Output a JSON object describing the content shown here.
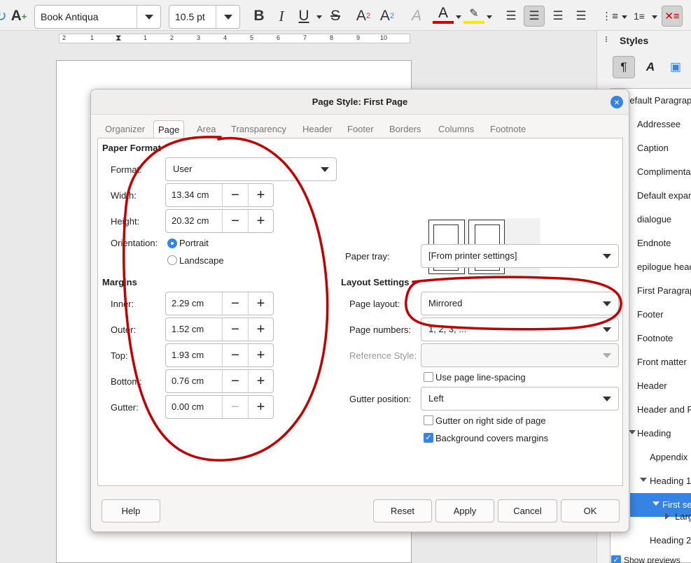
{
  "toolbar": {
    "font_name": "Book Antiqua",
    "font_size": "10.5 pt",
    "ruler_numbers": [
      "2",
      "1",
      "1",
      "2",
      "3",
      "4",
      "5",
      "6",
      "7",
      "8",
      "9",
      "10"
    ]
  },
  "sidebar": {
    "title": "Styles",
    "items": [
      {
        "label": "Default Paragraph"
      },
      {
        "label": "Addressee"
      },
      {
        "label": "Caption"
      },
      {
        "label": "Complimentary"
      },
      {
        "label": "Default expand"
      },
      {
        "label": "dialogue"
      },
      {
        "label": "Endnote"
      },
      {
        "label": "epilogue head"
      },
      {
        "label": "First Paragraph"
      },
      {
        "label": "Footer"
      },
      {
        "label": "Footnote"
      },
      {
        "label": "Front matter"
      },
      {
        "label": "Header"
      },
      {
        "label": "Header and F"
      },
      {
        "label": "Heading"
      },
      {
        "label": "Appendix"
      },
      {
        "label": "Heading 1"
      },
      {
        "label": "First se"
      },
      {
        "label": "Larg"
      },
      {
        "label": "Heading 2"
      }
    ],
    "show_previews": "Show previews"
  },
  "dialog": {
    "title": "Page Style: First Page",
    "tabs": [
      "Organizer",
      "Page",
      "Area",
      "Transparency",
      "Header",
      "Footer",
      "Borders",
      "Columns",
      "Footnote"
    ],
    "active_tab": "Page",
    "paper_format": {
      "section": "Paper Format",
      "format_label": "Format:",
      "format_value": "User",
      "width_label": "Width:",
      "width_value": "13.34 cm",
      "height_label": "Height:",
      "height_value": "20.32 cm",
      "orientation_label": "Orientation:",
      "portrait": "Portrait",
      "landscape": "Landscape",
      "paper_tray_label": "Paper tray:",
      "paper_tray_value": "[From printer settings]"
    },
    "margins": {
      "section": "Margins",
      "inner_label": "Inner:",
      "inner_value": "2.29 cm",
      "outer_label": "Outer:",
      "outer_value": "1.52 cm",
      "top_label": "Top:",
      "top_value": "1.93 cm",
      "bottom_label": "Bottom:",
      "bottom_value": "0.76 cm",
      "gutter_label": "Gutter:",
      "gutter_value": "0.00 cm"
    },
    "layout": {
      "section": "Layout Settings",
      "page_layout_label": "Page layout:",
      "page_layout_value": "Mirrored",
      "page_numbers_label": "Page numbers:",
      "page_numbers_value": "1, 2, 3, ...",
      "reference_style_label": "Reference Style:",
      "reference_style_value": "",
      "line_spacing_label": "Use page line-spacing",
      "gutter_position_label": "Gutter position:",
      "gutter_position_value": "Left",
      "gutter_right_label": "Gutter on right side of page",
      "bg_covers_label": "Background covers margins"
    },
    "buttons": {
      "help": "Help",
      "reset": "Reset",
      "apply": "Apply",
      "cancel": "Cancel",
      "ok": "OK"
    }
  },
  "colors": {
    "accent": "#3584e4",
    "annotation": "#c00000"
  }
}
